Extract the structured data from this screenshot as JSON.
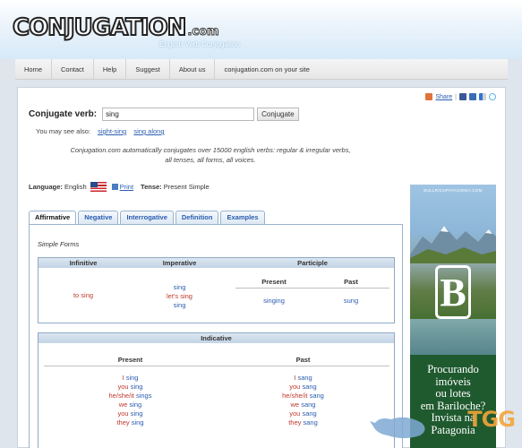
{
  "header": {
    "logo_text": "CONJUGATION",
    "logo_suffix": ".com",
    "tagline": "English Verb Conjugation"
  },
  "nav": {
    "items": [
      "Home",
      "Contact",
      "Help",
      "Suggest",
      "About us",
      "conjugation.com on your site"
    ]
  },
  "share": {
    "label": "Share"
  },
  "conjugate": {
    "label": "Conjugate verb:",
    "input_value": "sing",
    "button_label": "Conjugate"
  },
  "see_also": {
    "label": "You may see also:",
    "links": [
      "sight-sing",
      "sing along"
    ]
  },
  "description": {
    "line1": "Conjugation.com automatically conjugates over 15000 english verbs: regular & irregular verbs,",
    "line2": "all tenses, all forms, all voices."
  },
  "language_row": {
    "language_label": "Language:",
    "language_value": "English",
    "print_label": "Print",
    "tense_label": "Tense:",
    "tense_value": "Present Simple"
  },
  "tabs": [
    "Affirmative",
    "Negative",
    "Interrogative",
    "Definition",
    "Examples"
  ],
  "simple_forms": {
    "title": "Simple Forms",
    "headers": {
      "infinitive": "Infinitive",
      "imperative": "Imperative",
      "participle": "Participle"
    },
    "infinitive": "to sing",
    "imperative": [
      "sing",
      "let's sing",
      "sing"
    ],
    "participle_headers": [
      "Present",
      "Past"
    ],
    "participle_values": [
      "singing",
      "sung"
    ]
  },
  "indicative": {
    "title": "Indicative",
    "headers": [
      "Present",
      "Past"
    ],
    "present": [
      [
        "I",
        "sing"
      ],
      [
        "you",
        "sing"
      ],
      [
        "he/she/it",
        "sings"
      ],
      [
        "we",
        "sing"
      ],
      [
        "you",
        "sing"
      ],
      [
        "they",
        "sing"
      ]
    ],
    "past": [
      [
        "I",
        "sang"
      ],
      [
        "you",
        "sang"
      ],
      [
        "he/she/it",
        "sang"
      ],
      [
        "we",
        "sang"
      ],
      [
        "you",
        "sang"
      ],
      [
        "they",
        "sang"
      ]
    ]
  },
  "ad": {
    "url": "BULLRICHPATAGONIA.COM",
    "logo_letter": "B",
    "text_lines": [
      "Procurando",
      "imóveis",
      "ou lotes",
      "em Bariloche?",
      "Invista na",
      "Patagonia"
    ]
  },
  "watermark": {
    "text": "TGG"
  },
  "colors": {
    "link": "#2a5db0",
    "pronoun_red": "#c0392b",
    "tab_border": "#98b3cf",
    "header_blue": "#d7e9f8"
  }
}
